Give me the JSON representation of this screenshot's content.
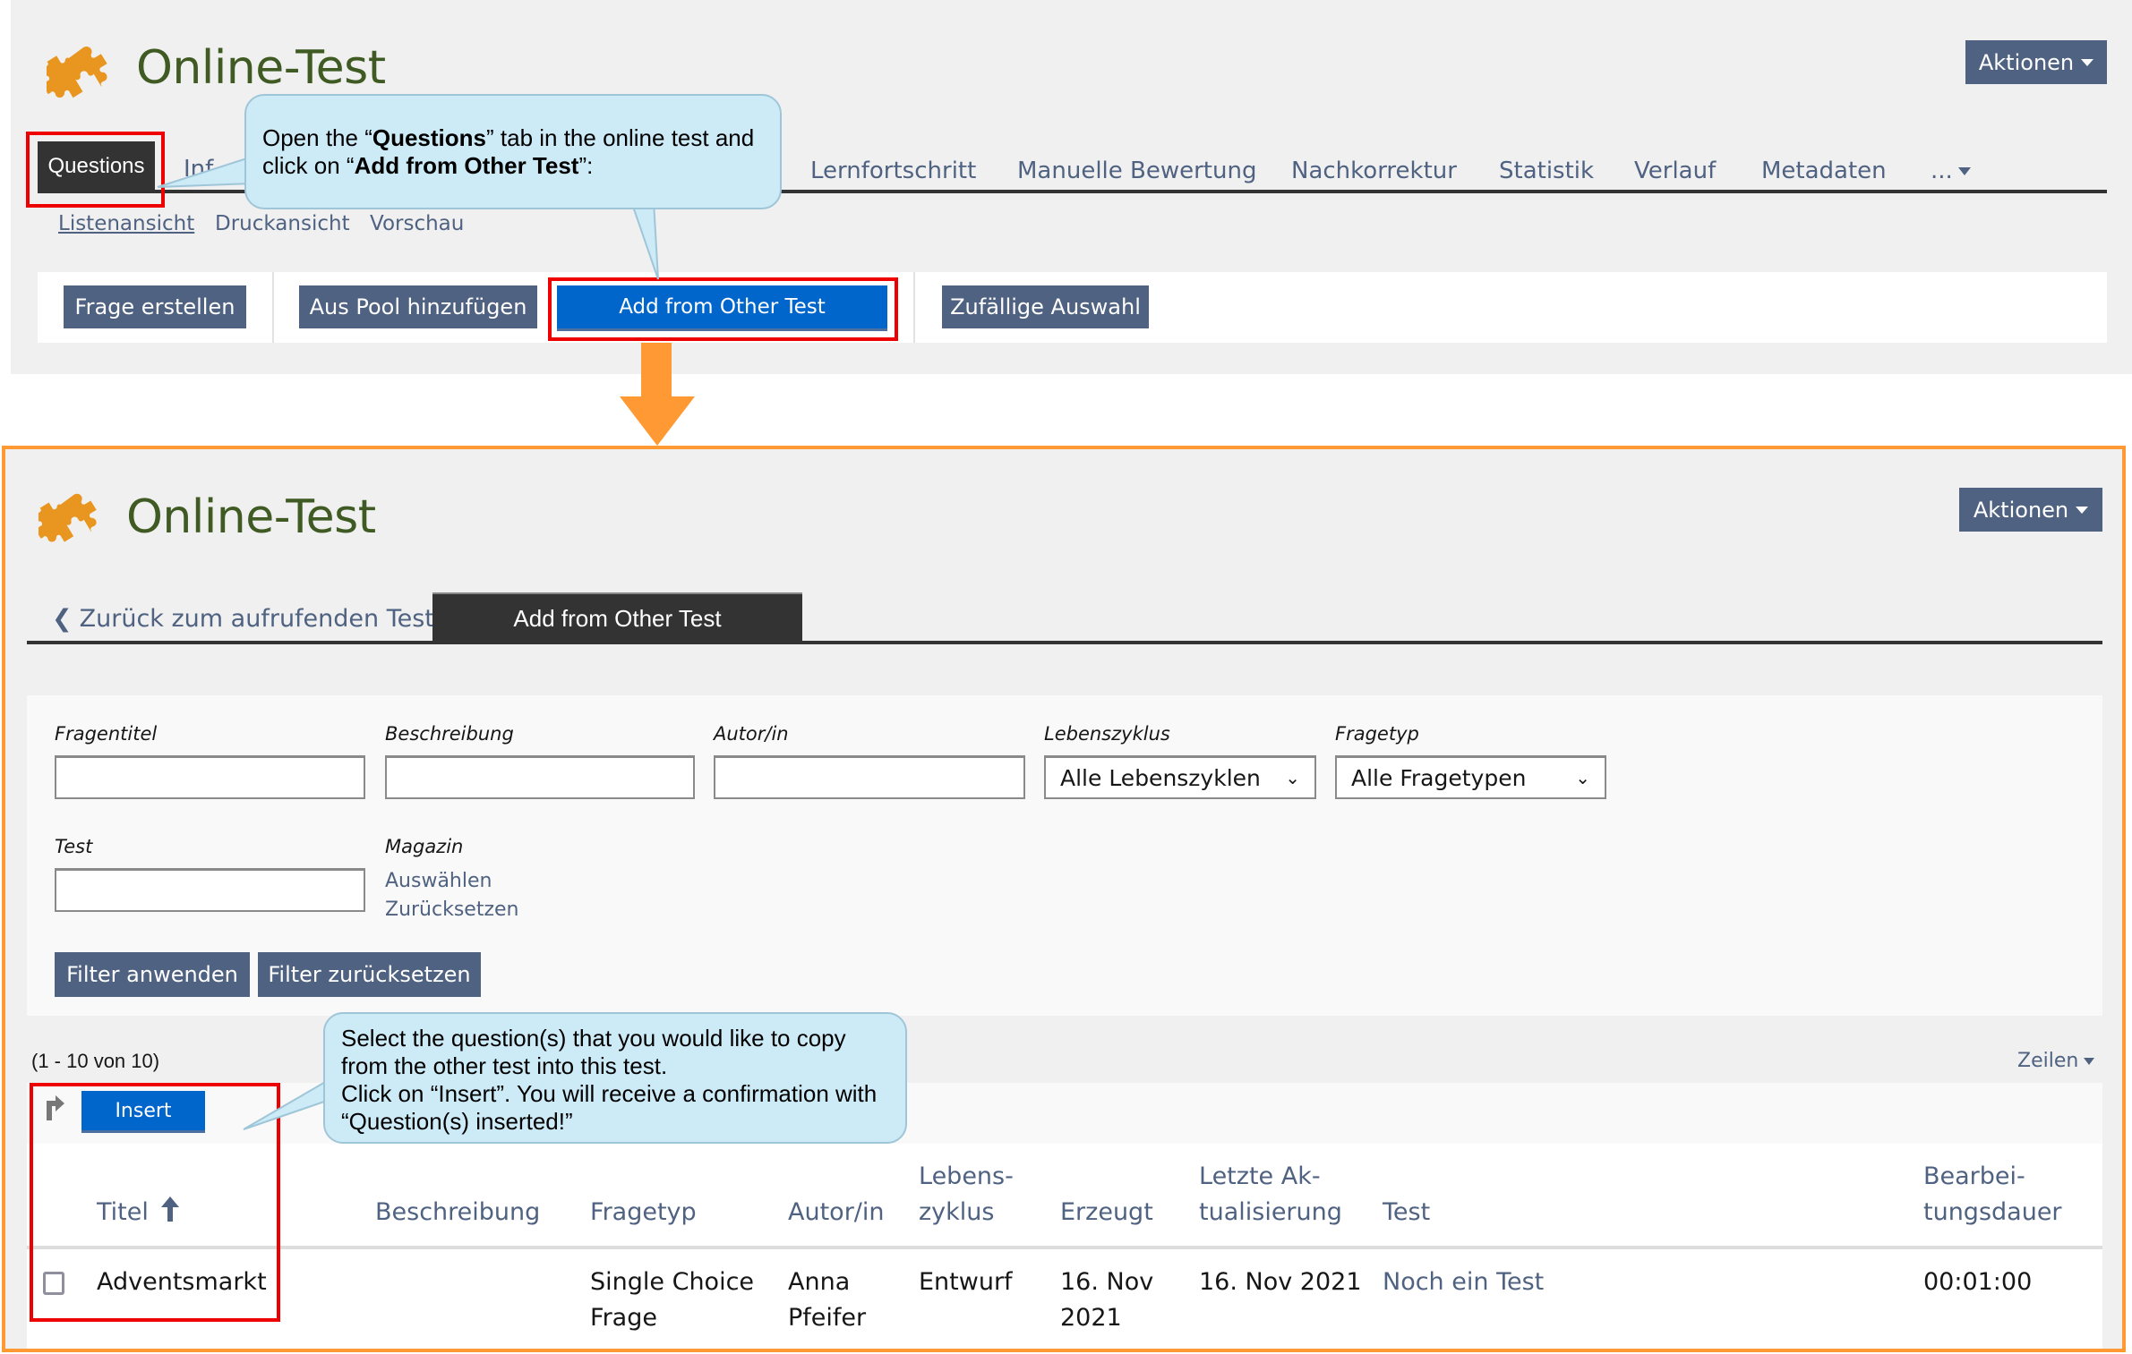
{
  "top_screen": {
    "title": "Online-Test",
    "actions_label": "Aktionen",
    "tabs": [
      {
        "label": "Questions",
        "active": true
      },
      {
        "label": "Inf"
      },
      {
        "label": "Lernfortschritt"
      },
      {
        "label": "Manuelle Bewertung"
      },
      {
        "label": "Nachkorrektur"
      },
      {
        "label": "Statistik"
      },
      {
        "label": "Verlauf"
      },
      {
        "label": "Metadaten"
      },
      {
        "label": "..."
      }
    ],
    "subtabs": [
      {
        "label": "Listenansicht",
        "active": true
      },
      {
        "label": "Druckansicht"
      },
      {
        "label": "Vorschau"
      }
    ],
    "toolbar": {
      "create_question": "Frage erstellen",
      "add_from_pool": "Aus Pool hinzufügen",
      "add_from_other_test": "Add from Other Test",
      "random_selection": "Zufällige Auswahl"
    },
    "callout": {
      "p1": "Open the “",
      "b1": "Questions",
      "p2": "” tab in the online test and click on “",
      "b2": "Add from Other Test",
      "p3": "”:"
    }
  },
  "bottom_screen": {
    "title": "Online-Test",
    "actions_label": "Aktionen",
    "back_tab": "Zurück zum aufrufenden Test",
    "active_tab": "Add from Other Test",
    "filter": {
      "fields": [
        {
          "label": "Fragentitel",
          "value": ""
        },
        {
          "label": "Beschreibung",
          "value": ""
        },
        {
          "label": "Autor/in",
          "value": ""
        }
      ],
      "lifecycle": {
        "label": "Lebenszyklus",
        "selected": "Alle Lebenszyklen"
      },
      "question_type": {
        "label": "Fragetyp",
        "selected": "Alle Fragetypen"
      },
      "test": {
        "label": "Test",
        "value": ""
      },
      "magazine": {
        "label": "Magazin",
        "select_link": "Auswählen",
        "reset_link": "Zurücksetzen"
      },
      "apply_label": "Filter anwenden",
      "reset_label": "Filter zurücksetzen"
    },
    "pagination": "(1 - 10 von 10)",
    "rows_label": "Zeilen",
    "insert_label": "Insert",
    "callout": {
      "line1": "Select the question(s) that you would like to copy",
      "line2": "from the other test into this test.",
      "line3": "Click on “Insert”. You will receive a confirmation with",
      "line4": "“Question(s) inserted!”"
    },
    "table": {
      "headers": {
        "title": "Titel",
        "description": "Beschreibung",
        "type": "Fragetyp",
        "author": "Autor/in",
        "lifecycle_1": "Lebens-",
        "lifecycle_2": "zyklus",
        "created": "Erzeugt",
        "updated_1": "Letzte Ak-",
        "updated_2": "tualisierung",
        "test": "Test",
        "duration_1": "Bearbei-",
        "duration_2": "tungsdauer"
      },
      "rows": [
        {
          "checked": false,
          "title": "Adventsmarkt",
          "description": "",
          "type_1": "Single Choice",
          "type_2": "Frage",
          "author_1": "Anna",
          "author_2": "Pfeifer",
          "lifecycle": "Entwurf",
          "created_1": "16. Nov",
          "created_2": "2021",
          "updated": "16. Nov 2021",
          "test": "Noch ein Test",
          "duration": "00:01:00"
        }
      ]
    }
  },
  "colors": {
    "accent_orange": "#ff9933",
    "highlight_red": "#ee0000",
    "button_dark": "#4f6281",
    "button_primary": "#0066cc",
    "title_green": "#3f5a22",
    "callout_bg": "#cdeaf7"
  }
}
